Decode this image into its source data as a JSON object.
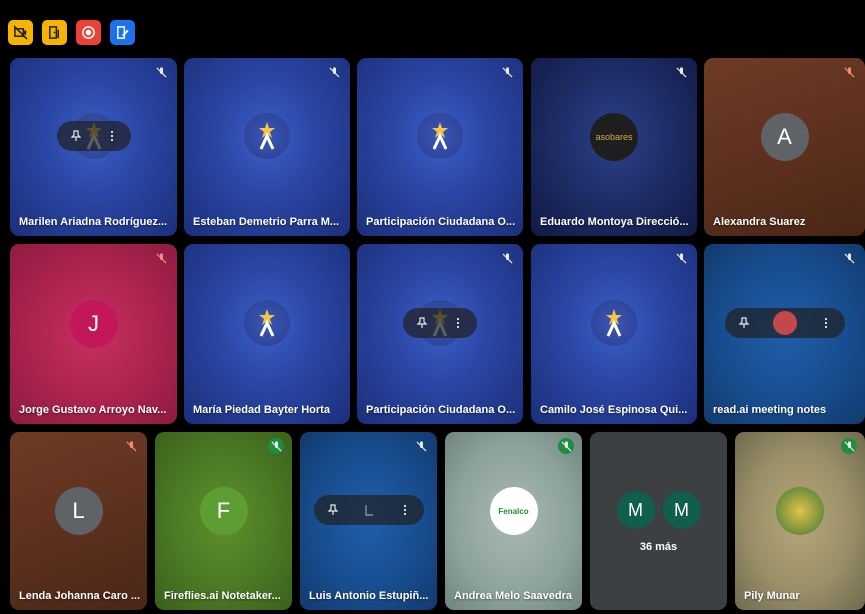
{
  "toolbar": {
    "buttons": [
      {
        "name": "hide-self-view",
        "color": "#f4b400"
      },
      {
        "name": "leave-panel",
        "color": "#f4b400"
      },
      {
        "name": "record",
        "color": "#ea4335"
      },
      {
        "name": "edit-notes",
        "color": "#1a73e8"
      }
    ]
  },
  "participants": [
    {
      "name": "Marilen Ariadna Rodríguez..."
    },
    {
      "name": "Esteban Demetrio Parra M..."
    },
    {
      "name": "Participación Ciudadana O..."
    },
    {
      "name": "Eduardo Montoya Direcció..."
    },
    {
      "name": "Alexandra Suarez",
      "initial": "A"
    },
    {
      "name": "Jorge Gustavo Arroyo Nav...",
      "initial": "J"
    },
    {
      "name": "María Piedad Bayter Horta"
    },
    {
      "name": "Participación Ciudadana O..."
    },
    {
      "name": "Camilo José Espinosa Qui..."
    },
    {
      "name": "read.ai meeting notes"
    },
    {
      "name": "Lenda Johanna Caro ...",
      "initial": "L"
    },
    {
      "name": "Fireflies.ai Notetaker...",
      "initial": "F"
    },
    {
      "name": "Luis Antonio Estupiñ..."
    },
    {
      "name": "Andrea Melo Saavedra",
      "logo_text": "Fenalco"
    },
    {
      "name": "Pily Munar"
    }
  ],
  "more": {
    "avatars": [
      "M",
      "M"
    ],
    "label": "36 más"
  },
  "eduardo_logo_text": "asobares",
  "colors": {
    "avatar_grey": "#5f6368",
    "avatar_pink": "#c2185b",
    "avatar_green": "#5c9e33",
    "mic_green": "#1e8e3e"
  }
}
